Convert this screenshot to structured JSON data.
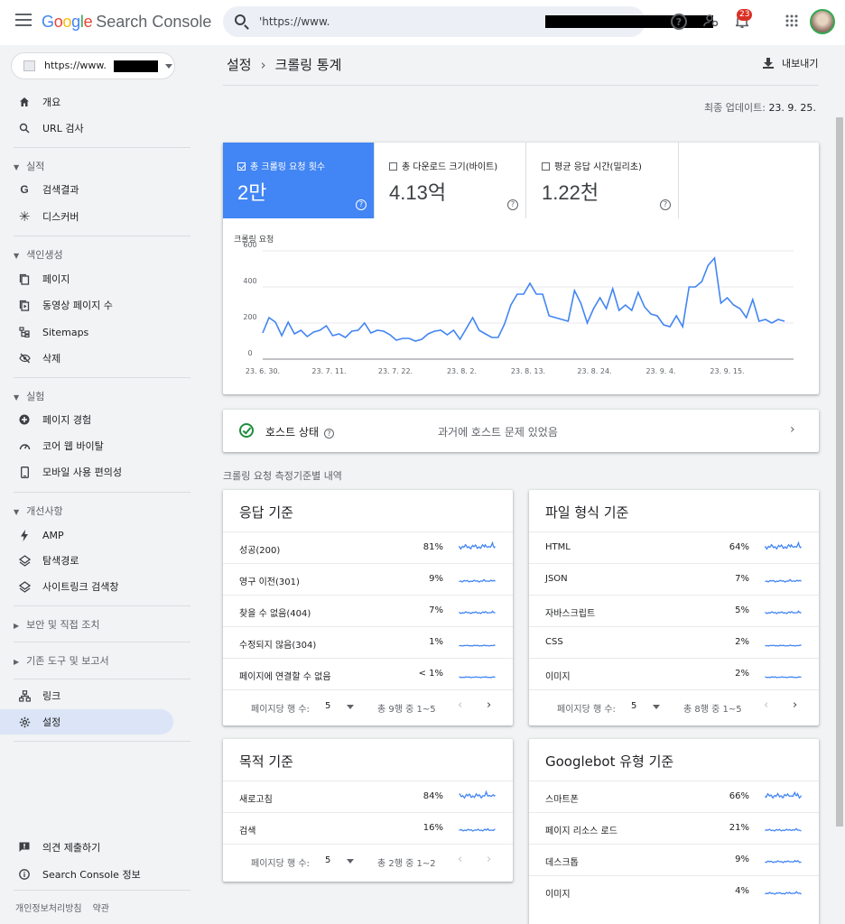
{
  "app": {
    "logo_google": "Google",
    "logo_product": "Search Console",
    "search_value": "'https://www."
  },
  "topbar": {
    "notifications_count": "23"
  },
  "property": {
    "label": "https://www."
  },
  "sidebar": {
    "items": [
      {
        "label": "개요",
        "icon": "home-icon"
      },
      {
        "label": "URL 검사",
        "icon": "search-icon"
      }
    ],
    "sec_performance": "실적",
    "performance_items": [
      {
        "label": "검색결과",
        "icon": "google-g-icon"
      },
      {
        "label": "디스커버",
        "icon": "asterisk-icon"
      }
    ],
    "sec_indexing": "색인생성",
    "indexing_items": [
      {
        "label": "페이지",
        "icon": "pages-icon"
      },
      {
        "label": "동영상 페이지 수",
        "icon": "video-page-icon"
      },
      {
        "label": "Sitemaps",
        "icon": "sitemap-icon"
      },
      {
        "label": "삭제",
        "icon": "eye-off-icon"
      }
    ],
    "sec_experience": "실험",
    "experience_items": [
      {
        "label": "페이지 경험",
        "icon": "plus-circle-icon"
      },
      {
        "label": "코어 웹 바이탈",
        "icon": "speedometer-icon"
      },
      {
        "label": "모바일 사용 편의성",
        "icon": "phone-icon"
      }
    ],
    "sec_enhancements": "개선사항",
    "enhancement_items": [
      {
        "label": "AMP",
        "icon": "bolt-icon"
      },
      {
        "label": "탐색경로",
        "icon": "layers-icon"
      },
      {
        "label": "사이트링크 검색창",
        "icon": "layers-icon"
      }
    ],
    "sec_security": "보안 및 직접 조치",
    "sec_legacy": "기존 도구 및 보고서",
    "links_label": "링크",
    "settings_label": "설정",
    "feedback_label": "의견 제출하기",
    "about_label": "Search Console 정보",
    "privacy_label": "개인정보처리방침",
    "terms_label": "약관"
  },
  "header": {
    "crumb_parent": "설정",
    "crumb_sep": "›",
    "crumb_current": "크롤링 통계",
    "export_label": "내보내기",
    "updated_label": "최종 업데이트:",
    "updated_value": "23. 9. 25."
  },
  "metrics": [
    {
      "label": "총 크롤링 요청 횟수",
      "value": "2만",
      "selected": true
    },
    {
      "label": "총 다운로드 크기(바이트)",
      "value": "4.13억",
      "selected": false
    },
    {
      "label": "평균 응답 시간(밀리초)",
      "value": "1.22천",
      "selected": false
    }
  ],
  "chart_data": {
    "type": "line",
    "ylabel": "크롤링 요청",
    "ylim": [
      0,
      600
    ],
    "yticks": [
      "600",
      "400",
      "200",
      "0"
    ],
    "xticks": [
      "23. 6. 30.",
      "23. 7. 11.",
      "23. 7. 22.",
      "23. 8. 2.",
      "23. 8. 13.",
      "23. 8. 24.",
      "23. 9. 4.",
      "23. 9. 15."
    ],
    "color": "#4285f4",
    "series": [
      {
        "values": [
          145,
          230,
          205,
          130,
          205,
          140,
          160,
          125,
          150,
          160,
          185,
          130,
          140,
          120,
          155,
          160,
          200,
          145,
          160,
          155,
          135,
          105,
          115,
          115,
          100,
          110,
          140,
          155,
          160,
          135,
          160,
          110,
          170,
          230,
          160,
          140,
          120,
          120,
          195,
          300,
          360,
          360,
          420,
          360,
          360,
          240,
          230,
          220,
          210,
          380,
          310,
          200,
          280,
          340,
          280,
          390,
          270,
          300,
          270,
          370,
          290,
          250,
          240,
          190,
          180,
          240,
          180,
          400,
          400,
          430,
          520,
          560,
          310,
          340,
          300,
          280,
          230,
          330,
          210,
          220,
          200,
          220,
          210
        ]
      }
    ]
  },
  "host_status": {
    "title": "호스트 상태",
    "message": "과거에 호스트 문제 있었음"
  },
  "breakdown_title": "크롤링 요청 측정기준별 내역",
  "breakdowns": {
    "response": {
      "title": "응답 기준",
      "rows": [
        {
          "name": "성공(200)",
          "pct": "81%"
        },
        {
          "name": "영구 이전(301)",
          "pct": "9%"
        },
        {
          "name": "찾을 수 없음(404)",
          "pct": "7%"
        },
        {
          "name": "수정되지 않음(304)",
          "pct": "1%"
        },
        {
          "name": "페이지에 연결할 수 없음",
          "pct": "< 1%"
        }
      ],
      "rows_per_page_label": "페이지당 행 수:",
      "rows_per_page": "5",
      "count": "총 9행 중 1~5"
    },
    "filetype": {
      "title": "파일 형식 기준",
      "rows": [
        {
          "name": "HTML",
          "pct": "64%"
        },
        {
          "name": "JSON",
          "pct": "7%"
        },
        {
          "name": "자바스크립트",
          "pct": "5%"
        },
        {
          "name": "CSS",
          "pct": "2%"
        },
        {
          "name": "이미지",
          "pct": "2%"
        }
      ],
      "rows_per_page_label": "페이지당 행 수:",
      "rows_per_page": "5",
      "count": "총 8행 중 1~5"
    },
    "purpose": {
      "title": "목적 기준",
      "rows": [
        {
          "name": "새로고침",
          "pct": "84%"
        },
        {
          "name": "검색",
          "pct": "16%"
        }
      ],
      "rows_per_page_label": "페이지당 행 수:",
      "rows_per_page": "5",
      "count": "총 2행 중 1~2"
    },
    "googlebot": {
      "title": "Googlebot 유형 기준",
      "rows": [
        {
          "name": "스마트폰",
          "pct": "66%"
        },
        {
          "name": "페이지 리소스 로드",
          "pct": "21%"
        },
        {
          "name": "데스크톱",
          "pct": "9%"
        },
        {
          "name": "이미지",
          "pct": "4%"
        }
      ]
    }
  }
}
